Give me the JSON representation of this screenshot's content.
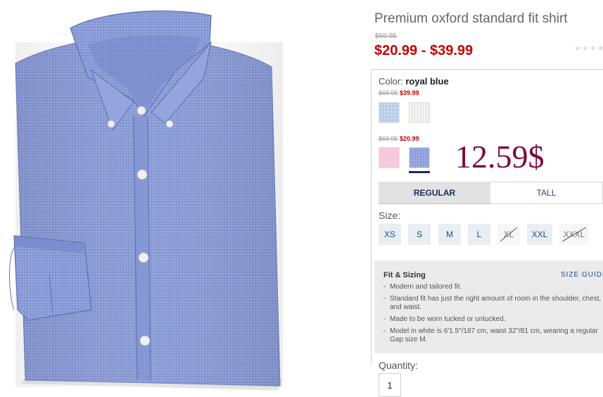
{
  "product": {
    "title": "Premium oxford standard fit shirt",
    "original_price": "$69.95",
    "price_range": "$20.99 - $39.99",
    "rating_stars": "★★★★★",
    "image_icon": "shirt-image"
  },
  "color": {
    "label": "Color:",
    "selected": "royal blue",
    "group1": {
      "original": "$69.95",
      "sale": "$39.99"
    },
    "group2": {
      "original": "$69.95",
      "sale": "$20.99"
    },
    "swatch_colors": {
      "light_blue_check": "#b9cde9",
      "white_stripe": "#f0efec",
      "pink": "#f7c9dc",
      "royal_blue": "#8d9ed8",
      "selected_bar": "#1e2a5a"
    }
  },
  "annotation": "12.59$",
  "fit_tabs": {
    "regular": "REGULAR",
    "tall": "TALL"
  },
  "sizes": {
    "label": "Size:",
    "options": [
      "XS",
      "S",
      "M",
      "L",
      "XL",
      "XXL",
      "XXXL"
    ],
    "unavailable": [
      "XL",
      "XXXL"
    ]
  },
  "fit_sizing": {
    "heading": "Fit & Sizing",
    "size_guide": "SIZE GUIDE",
    "items": [
      "Modern and tailored fit.",
      "Standard fit has just the right amount of room in the shoulder, chest, and waist.",
      "Made to be worn tucked or untucked.",
      "Model in white is 6'1.5\"/187 cm, waist 32\"/81 cm, wearing a regular Gap size M."
    ]
  },
  "quantity": {
    "label": "Quantity:",
    "value": "1"
  },
  "colors": {
    "price_red": "#c70000",
    "link_blue": "#1e4b82",
    "annotation": "#7a0a40"
  }
}
